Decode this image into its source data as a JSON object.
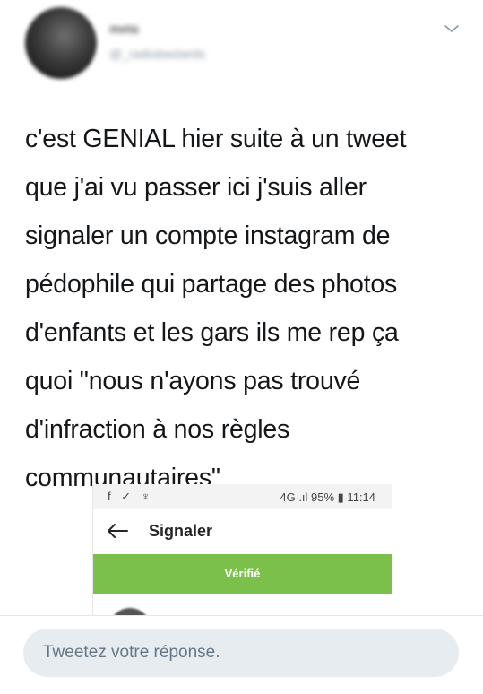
{
  "tweet": {
    "author_name": "meta",
    "author_handle": "@_radiobastards",
    "lines": [
      "c'est GENIAL hier suite à un tweet",
      "que j'ai vu passer ici j'suis aller",
      "signaler un compte instagram de",
      "pédophile qui partage des photos",
      "d'enfants et les gars ils me rep ça",
      "quoi \"nous n'ayons pas trouvé",
      "d'infraction à nos règles",
      "communautaires\""
    ]
  },
  "embedded_screenshot": {
    "status_icons": "f ✓ ♆",
    "status_right": "4G .ıl 95% ▮ 11:14",
    "title": "Signaler",
    "verified_label": "Vérifié"
  },
  "reply": {
    "placeholder": "Tweetez votre réponse."
  },
  "colors": {
    "text": "#14171a",
    "verified_green": "#7bc04a",
    "reply_bg": "#e6ecf0",
    "muted": "#657786"
  }
}
